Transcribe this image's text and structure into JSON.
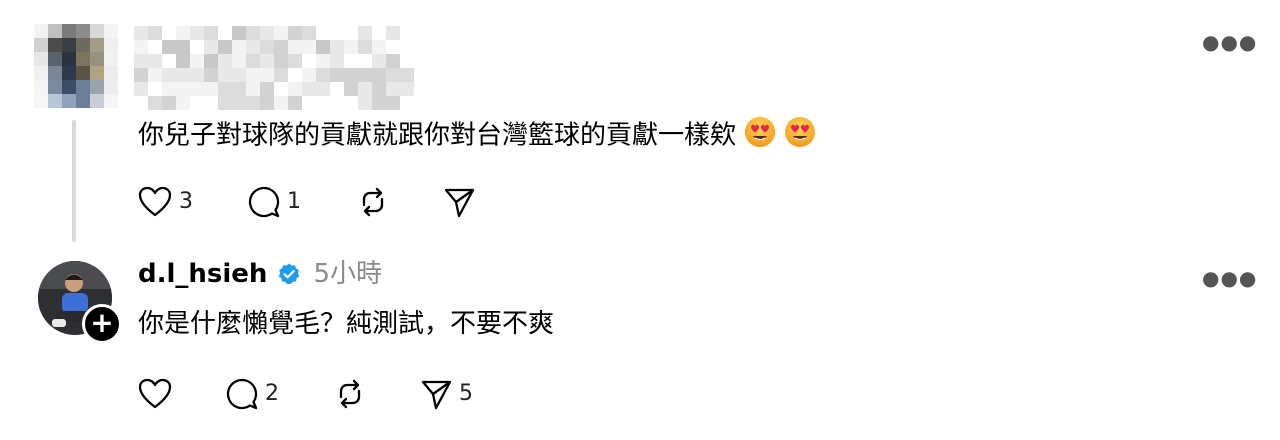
{
  "comment1": {
    "text": "你兒子對球隊的貢獻就跟你對台灣籃球的貢獻一樣欸",
    "emoji": "smiling-face-with-heart-eyes",
    "likes": "3",
    "replies": "1",
    "reposts": "",
    "shares": ""
  },
  "comment2": {
    "username": "d.l_hsieh",
    "time": "5小時",
    "text": "你是什麼懶覺毛？純測試，不要不爽",
    "likes": "",
    "replies": "2",
    "reposts": "",
    "shares": "5"
  },
  "icons": {
    "more": "more-horizontal",
    "like": "heart-outline",
    "reply": "speech-bubble-outline",
    "repost": "repost-arrows",
    "share": "paper-plane",
    "verified": "verified-badge",
    "follow": "plus-badge"
  },
  "colors": {
    "verified": "#1D9BF0",
    "muted": "#8a8a8a",
    "thread_line": "#d9d9d9"
  }
}
